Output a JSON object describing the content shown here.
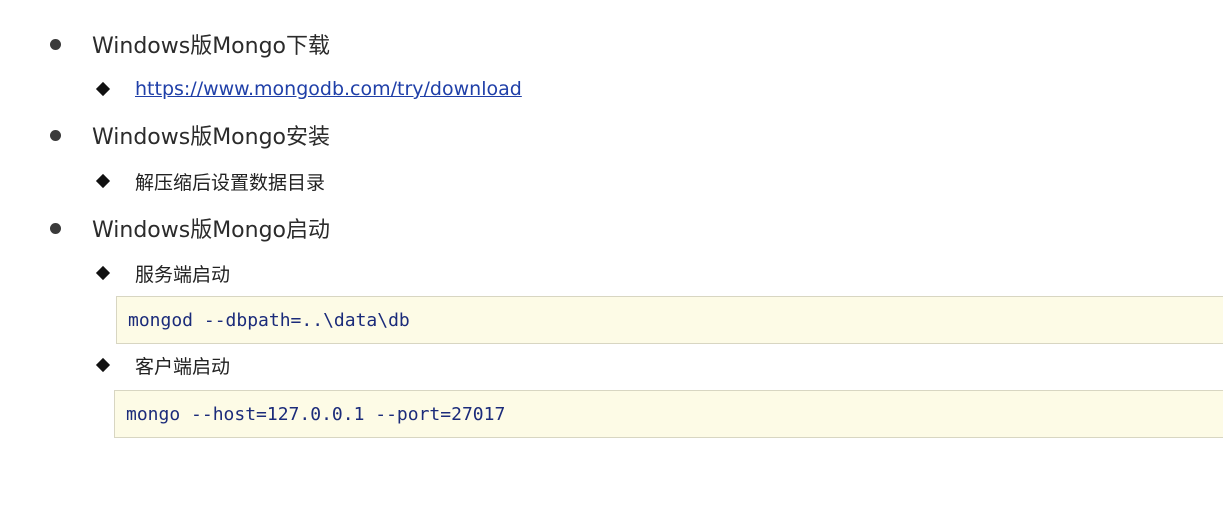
{
  "sections": [
    {
      "title": "Windows版Mongo下载",
      "items": [
        {
          "text": "https://www.mongodb.com/try/download",
          "is_link": true
        }
      ]
    },
    {
      "title": "Windows版Mongo安装",
      "items": [
        {
          "text": "解压缩后设置数据目录"
        }
      ]
    },
    {
      "title": "Windows版Mongo启动",
      "items": [
        {
          "text": "服务端启动",
          "code": "mongod --dbpath=..\\data\\db"
        },
        {
          "text": "客户端启动",
          "code": "mongo --host=127.0.0.1 --port=27017"
        }
      ]
    }
  ],
  "colors": {
    "link": "#1f3fa8",
    "code_background": "#fdfbe6",
    "code_text": "#1b2b7a",
    "code_border": "#d8d6c2"
  }
}
